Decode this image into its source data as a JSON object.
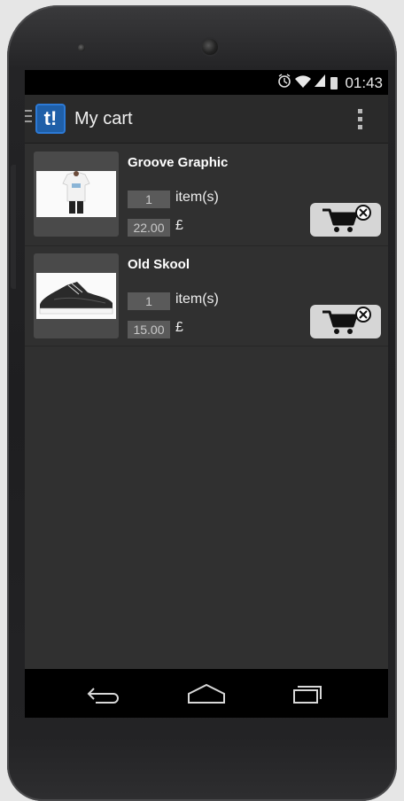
{
  "status_bar": {
    "time": "01:43",
    "icons": [
      "alarm-icon",
      "wifi-icon",
      "signal-icon",
      "battery-icon"
    ]
  },
  "action_bar": {
    "logo_text": "t!",
    "title": "My cart",
    "icons": [
      "drawer-icon",
      "overflow-menu-icon"
    ]
  },
  "cart": {
    "items": [
      {
        "name": "Groove Graphic",
        "quantity": "1",
        "quantity_label": "item(s)",
        "price": "22.00",
        "currency": "£",
        "image": "tshirt-image"
      },
      {
        "name": "Old Skool",
        "quantity": "1",
        "quantity_label": "item(s)",
        "price": "15.00",
        "currency": "£",
        "image": "sneaker-image"
      }
    ]
  },
  "nav_bar": {
    "icons": [
      "back-icon",
      "home-icon",
      "recent-apps-icon"
    ]
  },
  "colors": {
    "screen_bg": "#303030",
    "action_bar_bg": "#2a2a2a",
    "logo_blue": "#1f5fa8",
    "remove_button_bg": "#d6d6d6"
  }
}
